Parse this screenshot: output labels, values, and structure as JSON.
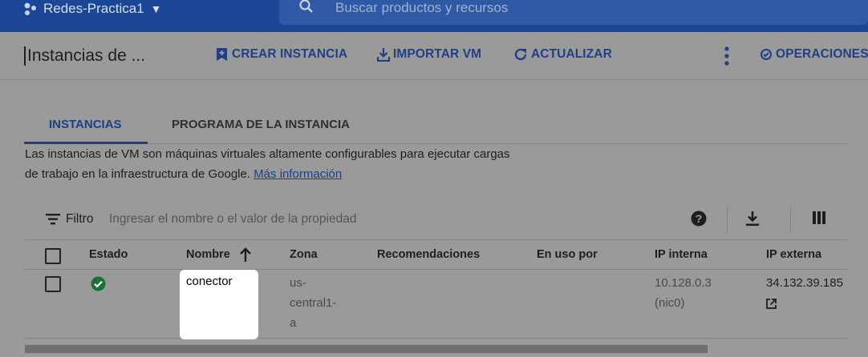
{
  "topbar": {
    "project_name": "Redes-Practica1",
    "project_icon": "project-dots-icon",
    "search_placeholder": "Buscar productos y recursos"
  },
  "actionbar": {
    "title": "Instancias de ...",
    "create_label": "CREAR INSTANCIA",
    "import_label": "IMPORTAR VM",
    "refresh_label": "ACTUALIZAR",
    "operations_label": "OPERACIONES"
  },
  "tabs": [
    {
      "label": "INSTANCIAS",
      "active": true
    },
    {
      "label": "PROGRAMA DE LA INSTANCIA",
      "active": false
    }
  ],
  "description": {
    "text": "Las instancias de VM son máquinas virtuales altamente configurables para ejecutar cargas de trabajo en la infraestructura de Google.",
    "link": "Más información"
  },
  "filter": {
    "label": "Filtro",
    "placeholder": "Ingresar el nombre o el valor de la propiedad"
  },
  "table": {
    "headers": {
      "status": "Estado",
      "name": "Nombre",
      "zone": "Zona",
      "recommendations": "Recomendaciones",
      "in_use_by": "En uso por",
      "internal_ip": "IP interna",
      "external_ip": "IP externa"
    },
    "sort": {
      "column": "Nombre",
      "direction": "ascending"
    },
    "rows": [
      {
        "status": "running",
        "name": "conector",
        "zone_lines": [
          "us-",
          "central1-",
          "a"
        ],
        "recommendations": "",
        "in_use_by": "",
        "internal_ip": "10.128.0.3",
        "internal_nic": "(nic0)",
        "external_ip": "34.132.39.185"
      }
    ]
  },
  "colors": {
    "header_blue": "#1c4796",
    "accent": "#1f3f86",
    "status_ok": "#1e6e3a",
    "backdrop": "#9a9a9a"
  }
}
